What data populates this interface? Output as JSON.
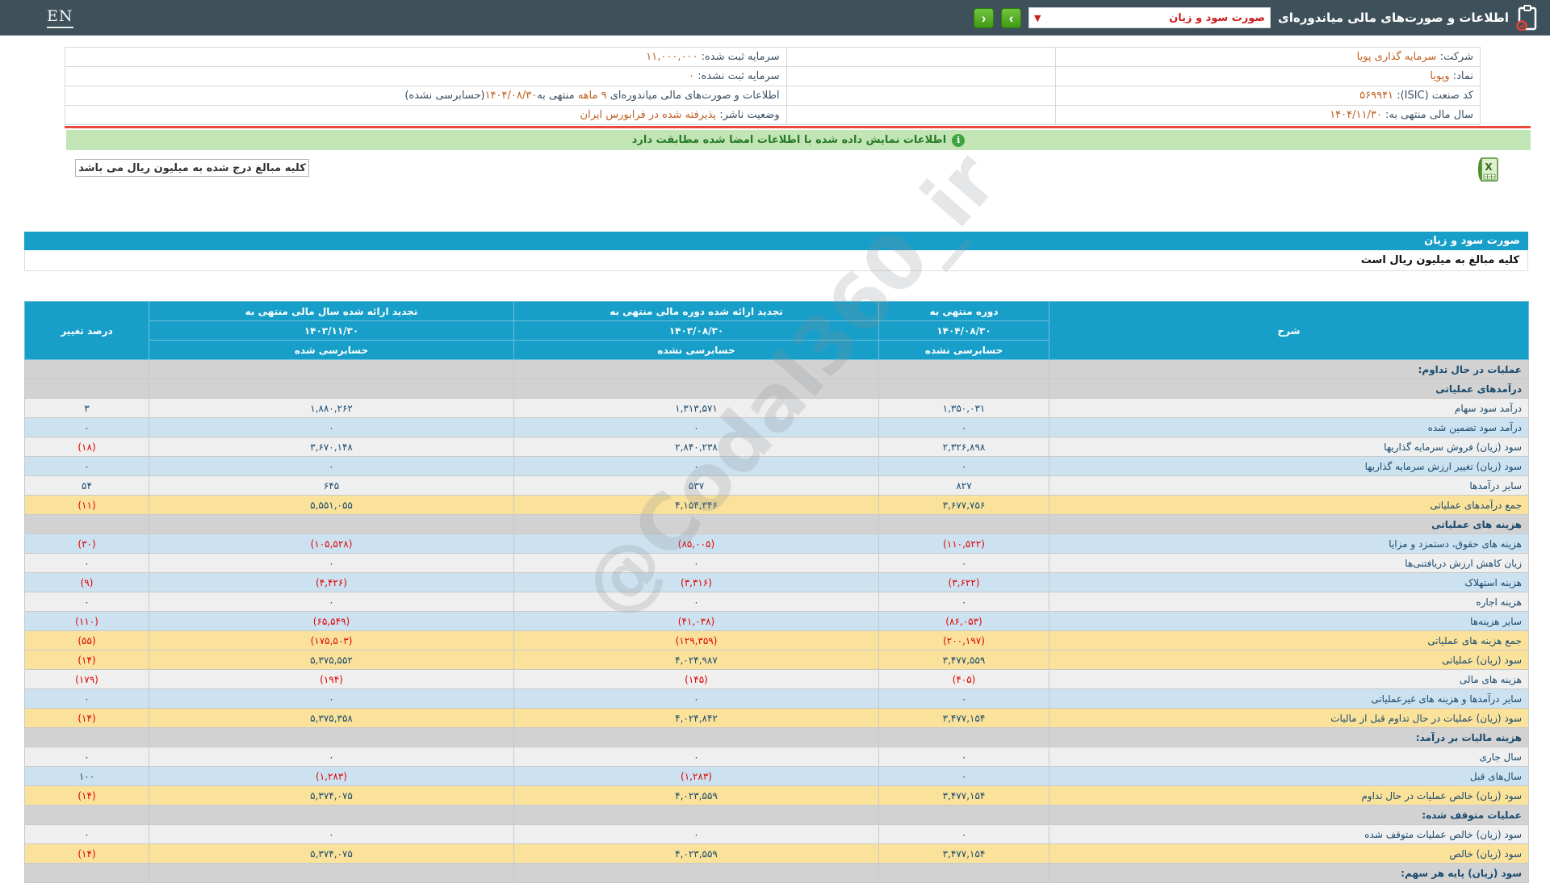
{
  "colors": {
    "topbar_bg": "#3e515a",
    "accent_blue": "#189fc9",
    "negative_red": "#e00404",
    "value_orange": "#bf5e1f",
    "highlight_yellow": "#fbe29b",
    "notice_green_bg": "#c2e5b5",
    "nav_button_green": "#3f9a14",
    "separator_red": "#e8493a"
  },
  "topbar": {
    "en_label": "EN",
    "title": "اطلاعات و صورت‌های مالی میاندوره‌ای",
    "dropdown_value": "صورت سود و زیان",
    "dropdown_caret": "▼",
    "nav_next": "›",
    "nav_prev": "‹"
  },
  "company_info": {
    "rows": [
      {
        "r_label": "شرکت:",
        "r_value": "سرمایه گذاری پویا",
        "l_label": "سرمایه ثبت شده:",
        "l_value": "۱۱,۰۰۰,۰۰۰"
      },
      {
        "r_label": "نماد:",
        "r_value": "وپویا",
        "l_label": "سرمایه ثبت نشده:",
        "l_value": "۰"
      },
      {
        "r_label": "کد صنعت (ISIC):",
        "r_value": "۵۶۹۹۴۱",
        "l_label": "اطلاعات و صورت‌های مالی میاندوره‌ای",
        "l_hl1": "۹ ماهه",
        "l_mid": "منتهی به",
        "l_hl2": "۱۴۰۴/۰۸/۳۰",
        "l_tail": "(حسابرسی نشده)"
      },
      {
        "r_label": "سال مالی منتهی به:",
        "r_value": "۱۴۰۴/۱۱/۳۰",
        "l_label": "وضعیت ناشر:",
        "l_value": "پذیرفته شده در فرابورس ایران"
      }
    ]
  },
  "notice": {
    "text": "اطلاعات نمایش داده شده با اطلاعات امضا شده مطابقت دارد",
    "icon": "i"
  },
  "units_note": "کلیه مبالغ درج شده به میلیون ریال می باشد",
  "statement": {
    "title": "صورت سود و زیان",
    "units": "کلیه مبالغ به میلیون ریال است"
  },
  "watermark": "@Codal360_ir",
  "table": {
    "header": {
      "desc": "شرح",
      "pct": "درصد تغییر",
      "cols": [
        {
          "title": "دوره منتهی به",
          "date": "۱۴۰۴/۰۸/۳۰",
          "audit": "حسابرسی نشده"
        },
        {
          "title": "تجدید ارائه شده دوره مالی منتهی به",
          "date": "۱۴۰۳/۰۸/۳۰",
          "audit": "حسابرسی نشده"
        },
        {
          "title": "تجدید ارائه شده سال مالی منتهی به",
          "date": "۱۴۰۳/۱۱/۳۰",
          "audit": "حسابرسی شده"
        }
      ]
    },
    "rows": [
      {
        "style": "section",
        "label": "عملیات در حال تداوم:",
        "v": [
          "",
          "",
          ""
        ],
        "pct": ""
      },
      {
        "style": "section",
        "label": "درآمدهای عملیاتی",
        "v": [
          "",
          "",
          ""
        ],
        "pct": ""
      },
      {
        "style": "light",
        "label": "درآمد سود سهام",
        "v": [
          "۱,۳۵۰,۰۳۱",
          "۱,۳۱۳,۵۷۱",
          "۱,۸۸۰,۲۶۲"
        ],
        "pct": "۳"
      },
      {
        "style": "blue",
        "label": "درآمد سود تضمین شده",
        "v": [
          "۰",
          "۰",
          "۰"
        ],
        "pct": "۰"
      },
      {
        "style": "light",
        "label": "سود (زیان) فروش سرمایه گذاریها",
        "v": [
          "۲,۳۲۶,۸۹۸",
          "۲,۸۴۰,۲۳۸",
          "۳,۶۷۰,۱۴۸"
        ],
        "pct": "(۱۸)"
      },
      {
        "style": "blue",
        "label": "سود (زیان) تغییر ارزش سرمایه گذاریها",
        "v": [
          "۰",
          "۰",
          "۰"
        ],
        "pct": "۰"
      },
      {
        "style": "light",
        "label": "سایر درآمدها",
        "v": [
          "۸۲۷",
          "۵۳۷",
          "۶۴۵"
        ],
        "pct": "۵۴"
      },
      {
        "style": "total",
        "label": "جمع درآمدهای عملیاتی",
        "v": [
          "۳,۶۷۷,۷۵۶",
          "۴,۱۵۴,۳۴۶",
          "۵,۵۵۱,۰۵۵"
        ],
        "pct": "(۱۱)"
      },
      {
        "style": "section",
        "label": "هزینه های عملیاتی",
        "v": [
          "",
          "",
          ""
        ],
        "pct": ""
      },
      {
        "style": "blue",
        "label": "هزینه های حقوق، دستمزد و مزایا",
        "v": [
          "(۱۱۰,۵۲۲)",
          "(۸۵,۰۰۵)",
          "(۱۰۵,۵۲۸)"
        ],
        "pct": "(۳۰)"
      },
      {
        "style": "light",
        "label": "زیان کاهش ارزش دریافتنی‌ها",
        "v": [
          "۰",
          "۰",
          "۰"
        ],
        "pct": "۰"
      },
      {
        "style": "blue",
        "label": "هزینه استهلاک",
        "v": [
          "(۳,۶۲۲)",
          "(۳,۳۱۶)",
          "(۴,۴۲۶)"
        ],
        "pct": "(۹)"
      },
      {
        "style": "light",
        "label": "هزینه اجاره",
        "v": [
          "۰",
          "۰",
          "۰"
        ],
        "pct": "۰"
      },
      {
        "style": "blue",
        "label": "سایر هزینه‌ها",
        "v": [
          "(۸۶,۰۵۳)",
          "(۴۱,۰۳۸)",
          "(۶۵,۵۴۹)"
        ],
        "pct": "(۱۱۰)"
      },
      {
        "style": "total",
        "label": "جمع هزینه های عملیاتی",
        "v": [
          "(۲۰۰,۱۹۷)",
          "(۱۲۹,۳۵۹)",
          "(۱۷۵,۵۰۳)"
        ],
        "pct": "(۵۵)"
      },
      {
        "style": "total",
        "label": "سود (زیان) عملیاتی",
        "v": [
          "۳,۴۷۷,۵۵۹",
          "۴,۰۲۴,۹۸۷",
          "۵,۳۷۵,۵۵۲"
        ],
        "pct": "(۱۴)"
      },
      {
        "style": "light",
        "label": "هزینه های مالی",
        "v": [
          "(۴۰۵)",
          "(۱۴۵)",
          "(۱۹۴)"
        ],
        "pct": "(۱۷۹)"
      },
      {
        "style": "blue",
        "label": "سایر درآمدها و هزینه های غیرعملیاتی",
        "v": [
          "۰",
          "۰",
          "۰"
        ],
        "pct": "۰"
      },
      {
        "style": "total",
        "label": "سود (زیان) عملیات در حال تداوم قبل از مالیات",
        "v": [
          "۳,۴۷۷,۱۵۴",
          "۴,۰۲۴,۸۴۲",
          "۵,۳۷۵,۳۵۸"
        ],
        "pct": "(۱۴)"
      },
      {
        "style": "section",
        "label": "هزینه مالیات بر درآمد:",
        "v": [
          "",
          "",
          ""
        ],
        "pct": ""
      },
      {
        "style": "light",
        "label": "سال جاری",
        "v": [
          "۰",
          "۰",
          "۰"
        ],
        "pct": "۰"
      },
      {
        "style": "blue",
        "label": "سال‌های قبل",
        "v": [
          "۰",
          "(۱,۲۸۳)",
          "(۱,۲۸۳)"
        ],
        "pct": "۱۰۰"
      },
      {
        "style": "total",
        "label": "سود (زیان) خالص عملیات در حال تداوم",
        "v": [
          "۳,۴۷۷,۱۵۴",
          "۴,۰۲۳,۵۵۹",
          "۵,۳۷۴,۰۷۵"
        ],
        "pct": "(۱۴)"
      },
      {
        "style": "section",
        "label": "عملیات متوقف شده:",
        "v": [
          "",
          "",
          ""
        ],
        "pct": ""
      },
      {
        "style": "light",
        "label": "سود (زیان) خالص عملیات متوقف شده",
        "v": [
          "۰",
          "۰",
          "۰"
        ],
        "pct": "۰"
      },
      {
        "style": "total",
        "label": "سود (زیان) خالص",
        "v": [
          "۳,۴۷۷,۱۵۴",
          "۴,۰۲۳,۵۵۹",
          "۵,۳۷۴,۰۷۵"
        ],
        "pct": "(۱۴)"
      },
      {
        "style": "section",
        "label": "سود (زیان) پایه هر سهم:",
        "v": [
          "",
          "",
          ""
        ],
        "pct": ""
      }
    ]
  }
}
